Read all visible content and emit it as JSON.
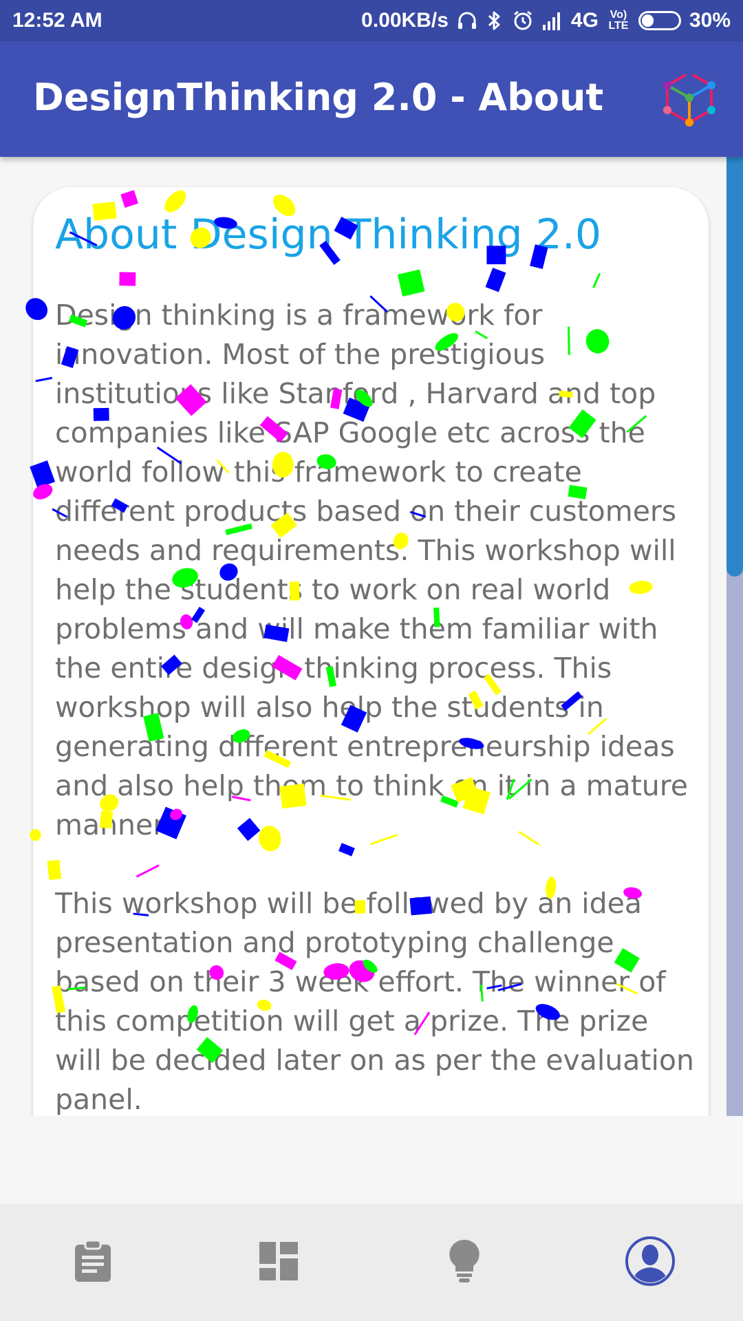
{
  "status_bar": {
    "time": "12:52 AM",
    "network_speed": "0.00KB/s",
    "network_type": "4G",
    "volte": "Vo) LTE",
    "battery_percent": "30%",
    "battery_level": 0.3,
    "icons": [
      "headset-icon",
      "bluetooth-icon",
      "alarm-icon",
      "signal-icon",
      "battery-icon"
    ]
  },
  "app_bar": {
    "title": "DesignThinking 2.0 - About",
    "logo_icon": "hexagon-cube-logo-icon",
    "color": "#3f51b5"
  },
  "card": {
    "title": "About Design Thinking 2.0",
    "paragraphs": [
      "Design thinking is a framework for innovation. Most of the prestigious institutions like Stanford , Harvard and top companies like SAP Google etc across the world follow this framework to create different products based on their customers needs and requirements. This workshop will help the students to work on real world problems and will make them familiar with the entire design thinking process. This workshop will also help the students in generating different entrepreneurship ideas and also help them to think on it in a mature manner.",
      "This workshop will be followed by an idea presentation and prototyping challenge based on their 3 week effort. The winner of this competition will get a prize. The prize will be decided later on as per the evaluation panel."
    ],
    "title_color": "#1aa3e6",
    "text_color": "#6f6f6f"
  },
  "confetti": {
    "colors": [
      "#00ff00",
      "#0000ff",
      "#ff00ff",
      "#ffff00"
    ]
  },
  "scroll": {
    "position_fraction": 0.0,
    "visible_fraction": 0.44
  },
  "bottom_nav": {
    "items": [
      {
        "icon": "clipboard-icon",
        "selected": false
      },
      {
        "icon": "dashboard-icon",
        "selected": false
      },
      {
        "icon": "lightbulb-icon",
        "selected": false
      },
      {
        "icon": "profile-icon",
        "selected": true
      }
    ],
    "active_color": "#3f51b5",
    "inactive_color": "#8a8a8a"
  }
}
